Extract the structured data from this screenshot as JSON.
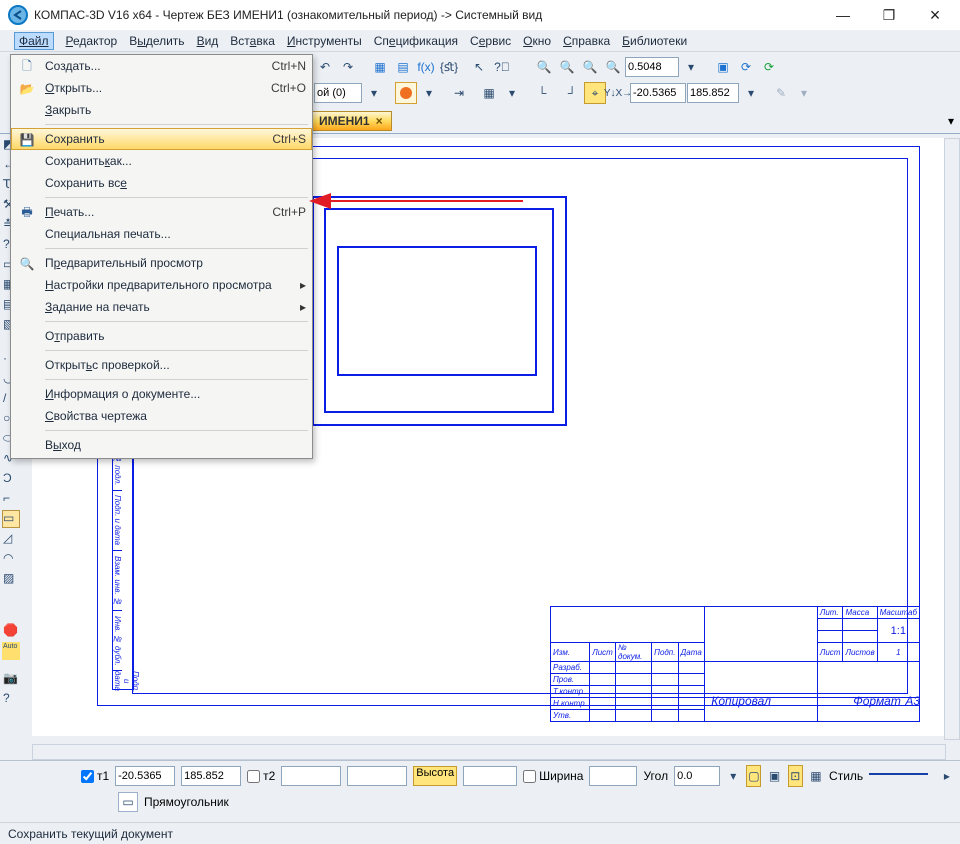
{
  "title": "КОМПАС-3D V16 x64 - Чертеж БЕЗ ИМЕНИ1 (ознакомительный период) -> Системный вид",
  "menu": {
    "file": "Файл",
    "editor": "Редактор",
    "select": "Выделить",
    "view": "Вид",
    "insert": "Вставка",
    "tools": "Инструменты",
    "spec": "Спецификация",
    "service": "Сервис",
    "window": "Окно",
    "help": "Справка",
    "libs": "Библиотеки"
  },
  "tab": {
    "label": "ИМЕНИ1",
    "close": "×"
  },
  "zoom_value": "0.5048",
  "layer_combo": "ой (0)",
  "coord_x": "-20.5365",
  "coord_y": "185.852",
  "xy_label": "Y↓X→",
  "file_menu": {
    "create": {
      "label": "Создать...",
      "shortcut": "Ctrl+N"
    },
    "open": {
      "label": "Открыть...",
      "shortcut": "Ctrl+O"
    },
    "close": {
      "label": "Закрыть"
    },
    "save": {
      "label": "Сохранить",
      "shortcut": "Ctrl+S"
    },
    "save_as": {
      "label": "Сохранить как..."
    },
    "save_all": {
      "label": "Сохранить все"
    },
    "print": {
      "label": "Печать...",
      "shortcut": "Ctrl+P"
    },
    "special_print": {
      "label": "Специальная печать..."
    },
    "preview": {
      "label": "Предварительный просмотр"
    },
    "preview_settings": {
      "label": "Настройки предварительного просмотра"
    },
    "print_task": {
      "label": "Задание на печать"
    },
    "send": {
      "label": "Отправить"
    },
    "open_check": {
      "label": "Открыть с проверкой..."
    },
    "doc_info": {
      "label": "Информация о документе..."
    },
    "drawing_props": {
      "label": "Свойства чертежа"
    },
    "exit": {
      "label": "Выход"
    }
  },
  "titleblock": {
    "left": [
      "Инб. № подл.",
      "Подп. и дата",
      "Взам. инв. №",
      "Инв. № дубл.",
      "Подп. и дата"
    ],
    "cols": [
      "Изм.",
      "Лист",
      "№ докум.",
      "Подп.",
      "Дата"
    ],
    "roles": [
      "Разраб.",
      "Пров.",
      "Т.контр."
    ],
    "roles2": [
      "Н.контр.",
      "Утв."
    ],
    "rcols": [
      "Лит.",
      "Масса",
      "Масштаб"
    ],
    "scale": "1:1",
    "sheet": "Лист",
    "sheets": "Листов",
    "sheets_n": "1",
    "copied": "Копировал",
    "format": "Формат",
    "format_v": "A3"
  },
  "bottom": {
    "t1_label": "т1",
    "t2_label": "т2",
    "x1": "-20.5365",
    "y1": "185.852",
    "height": "Высота",
    "width": "Ширина",
    "angle": "Угол",
    "angle_v": "0.0",
    "style": "Стиль",
    "shape": "Прямоугольник"
  },
  "status": "Сохранить текущий документ"
}
